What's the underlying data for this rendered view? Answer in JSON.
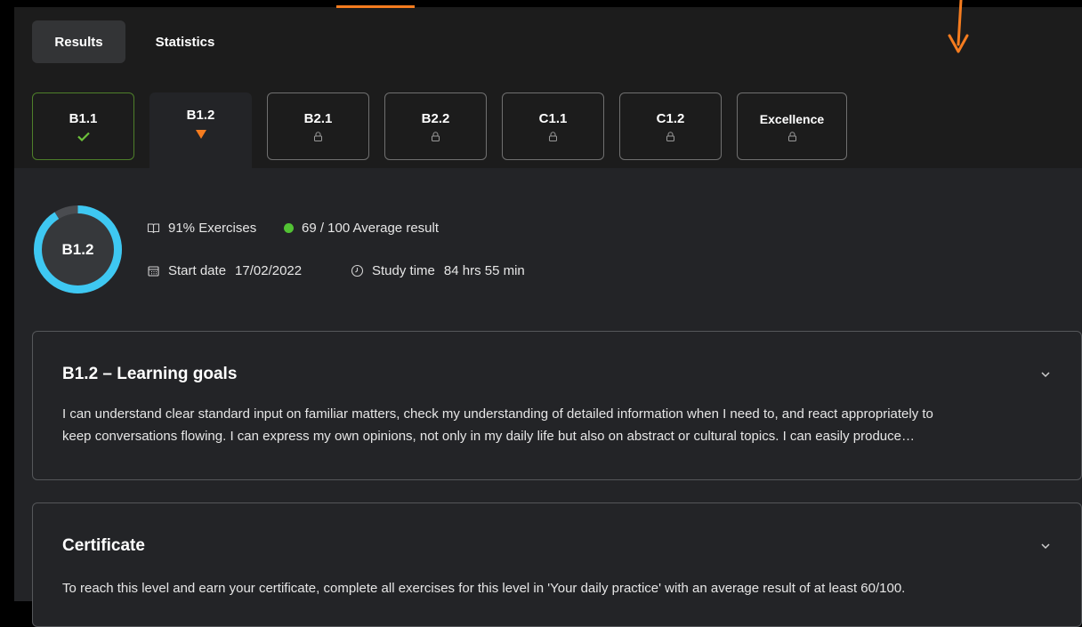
{
  "tabs": [
    {
      "label": "Results",
      "active": true
    },
    {
      "label": "Statistics",
      "active": false
    }
  ],
  "levels": [
    {
      "label": "B1.1",
      "status": "completed",
      "icon": "check-icon"
    },
    {
      "label": "B1.2",
      "status": "current",
      "icon": "triangle-down-icon"
    },
    {
      "label": "B2.1",
      "status": "locked",
      "icon": "lock-icon"
    },
    {
      "label": "B2.2",
      "status": "locked",
      "icon": "lock-icon"
    },
    {
      "label": "C1.1",
      "status": "locked",
      "icon": "lock-icon"
    },
    {
      "label": "C1.2",
      "status": "locked",
      "icon": "lock-icon"
    },
    {
      "label": "Excellence",
      "status": "locked",
      "icon": "lock-icon"
    }
  ],
  "progress": {
    "level": "B1.2",
    "ring_fraction": 0.91,
    "exercises": "91% Exercises",
    "average_result": "69 / 100 Average result",
    "start_date_label": "Start date",
    "start_date": "17/02/2022",
    "study_time_label": "Study time",
    "study_time": "84 hrs 55 min"
  },
  "goals_card": {
    "title": "B1.2 – Learning goals",
    "body_line1": "I can understand clear standard input on familiar matters, check my understanding of detailed information when I need to, and react appropriately to",
    "body_line2": "keep conversations flowing. I can express my own opinions, not only in my daily life but also on abstract or cultural topics. I can easily produce…"
  },
  "certificate_card": {
    "title": "Certificate",
    "body": "To reach this level and earn your certificate, complete all exercises for this level in 'Your daily practice' with an average result of at least 60/100."
  },
  "colors": {
    "accent": "#f57c1f",
    "ring": "#3ec8f2",
    "success": "#6cc13a",
    "dot": "#52c234"
  }
}
